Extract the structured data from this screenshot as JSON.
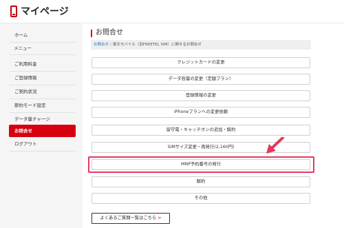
{
  "header": {
    "title": "マイページ",
    "logo_icon": "phone-icon",
    "accent": "#bf0000"
  },
  "sidebar": {
    "home": "ホーム",
    "menu_heading": "メニュー",
    "items": [
      {
        "label": "ご利用料金",
        "active": false
      },
      {
        "label": "ご登録情報",
        "active": false
      },
      {
        "label": "ご契約状況",
        "active": false
      },
      {
        "label": "節約モード設定",
        "active": false
      },
      {
        "label": "データ量チャージ",
        "active": false
      },
      {
        "label": "お問合せ",
        "active": true
      },
      {
        "label": "ログアウト",
        "active": false
      }
    ],
    "active_color": "#d7000f"
  },
  "main": {
    "title": "お問合せ",
    "breadcrumb": {
      "link": "お問合せ",
      "separator": "/",
      "current": "楽天モバイル（旧FREETEL SIM）に関するお問合せ"
    },
    "menu": [
      "クレジットカードの変更",
      "データ容量の変更（定額プラン）",
      "登録情報の変更",
      "iPhoneプランへの変更依頼",
      "留守電・キャッチホンの追加・解約",
      "SIMサイズ変更・再発行(2,160円)",
      "MNP予約番号の発行",
      "解約",
      "その他"
    ],
    "highlighted_item": "MNP予約番号の発行",
    "highlight_color": "#e5385e",
    "faq_button": "よくあるご質問一覧はこちら",
    "faq_chevron": ">"
  }
}
